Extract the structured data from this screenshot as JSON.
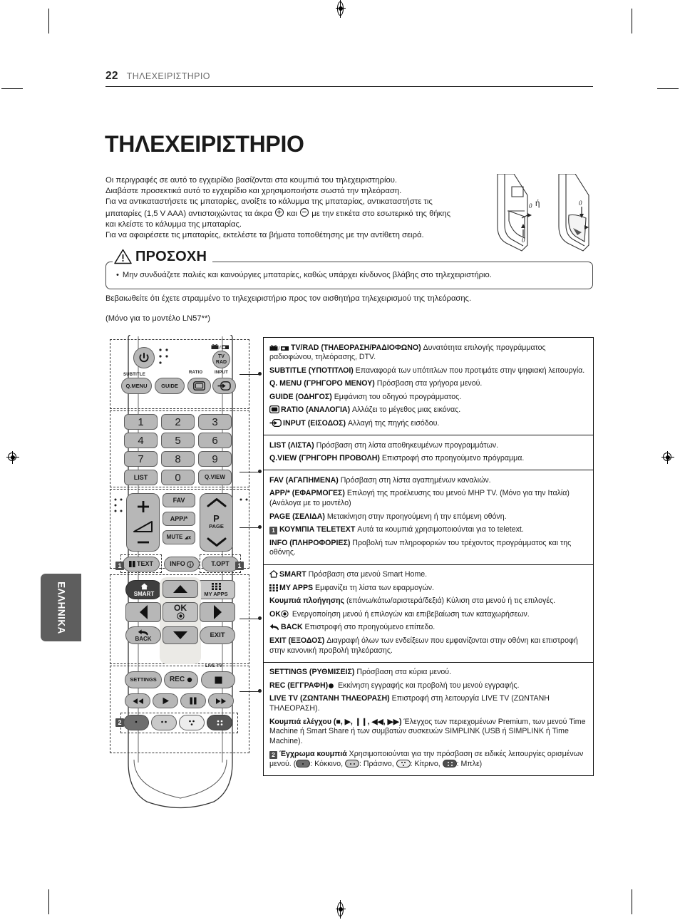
{
  "header": {
    "page_number": "22",
    "breadcrumb": "ΤΗΛΕΧΕΙΡΙΣΤΗΡΙΟ"
  },
  "title": "ΤΗΛΕΧΕΙΡΙΣΤΗΡΙΟ",
  "intro": {
    "line1": "Οι περιγραφές σε αυτό το εγχειρίδιο βασίζονται στα κουμπιά του τηλεχειριστηρίου.",
    "line2": "Διαβάστε προσεκτικά αυτό το εγχειρίδιο και χρησιμοποιήστε σωστά την τηλεόραση.",
    "line3": "Για να αντικαταστήσετε τις μπαταρίες, ανοίξτε το κάλυμμα της μπαταρίας, αντικαταστήστε τις",
    "line4a": "μπαταρίες (1,5 V AAA) αντιστοιχώντας τα άκρα",
    "line4b": "και",
    "line4c": "με την ετικέτα στο εσωτερικό της θήκης",
    "line5": "και κλείστε το κάλυμμα της μπαταρίας.",
    "line6": "Για να αφαιρέσετε τις μπαταρίες, εκτελέστε τα βήματα τοποθέτησης με την αντίθετη σειρά."
  },
  "battery_illustration": {
    "or_label": "ή"
  },
  "caution": {
    "label": "ΠΡΟΣΟΧΗ",
    "bullet_marker": "•",
    "bullet_text": "Μην συνδυάζετε παλιές και καινούργιες μπαταρίες, καθώς υπάρχει κίνδυνος βλάβης στο τηλεχειριστήριο."
  },
  "notes": {
    "note1": "Βεβαιωθείτε ότι έχετε στραμμένο το τηλεχειριστήριο προς τον αισθητήρα τηλεχειρισμού της τηλεόρασης.",
    "note2": "(Μόνο για το μοντέλο LN57**)"
  },
  "language_tab": {
    "label": "ΕΛΛΗΝΙΚΑ"
  },
  "remote": {
    "captions": {
      "subtitle": "SUBTITLE",
      "ratio": "RATIO",
      "input": "INPUT",
      "live_tv": "LIVE TV",
      "tvrad": "TV/RAD"
    },
    "buttons": {
      "power": "⏻",
      "tvrad": "TV\nRAD",
      "qmenu": "Q.MENU",
      "guide": "GUIDE",
      "ratio": "",
      "input": "",
      "n1": "1",
      "n2": "2",
      "n3": "3",
      "n4": "4",
      "n5": "5",
      "n6": "6",
      "n7": "7",
      "n8": "8",
      "n9": "9",
      "list": "LIST",
      "n0": "0",
      "qview": "Q.VIEW",
      "volume": "",
      "fav": "FAV",
      "app": "APP/*",
      "mute": "MUTE",
      "page": "P",
      "page_label": "PAGE",
      "text": "TEXT",
      "info": "INFO",
      "topt": "T.OPT",
      "smart": "SMART",
      "myapps": "MY APPS",
      "ok": "OK",
      "back": "BACK",
      "exit": "EXIT",
      "settings": "SETTINGS",
      "rec": "REC",
      "stop": "■",
      "rewind": "◀◀",
      "play": "▶",
      "pause": "❚❚",
      "forward": "▶▶"
    },
    "callouts": {
      "teletext": "1",
      "color": "2"
    }
  },
  "descriptions": [
    {
      "group": 1,
      "items": [
        {
          "icon": "tv-radio-icon",
          "bold": "TV/RAD (ΤΗΛΕΟΡΑΣΗ/ΡΑΔΙΟΦΩΝΟ)",
          "text": " Δυνατότητα επιλογής προγράμματος ραδιοφώνου, τηλεόρασης, DTV."
        },
        {
          "icon": null,
          "bold": "SUBTITLE (ΥΠΟΤΙΤΛΟΙ)",
          "text": " Επαναφορά των υπότιτλων που προτιμάτε στην ψηφιακή λειτουργία."
        },
        {
          "icon": null,
          "bold": "Q. MENU (ΓΡΗΓΟΡΟ ΜΕΝΟΥ)",
          "text": " Πρόσβαση στα γρήγορα μενού."
        },
        {
          "icon": null,
          "bold": "GUIDE (ΟΔΗΓΟΣ)",
          "text": " Εμφάνιση του οδηγού προγράμματος."
        },
        {
          "icon": "ratio-icon",
          "bold": "RATIO (ΑΝΑΛΟΓΙΑ)",
          "text": " Αλλάζει το μέγεθος μιας εικόνας."
        },
        {
          "icon": "input-icon",
          "bold": "INPUT (ΕΙΣΟΔΟΣ)",
          "text": " Αλλαγή της πηγής εισόδου."
        }
      ]
    },
    {
      "group": 2,
      "items": [
        {
          "icon": null,
          "bold": "LIST (ΛΙΣΤΑ)",
          "text": " Πρόσβαση στη λίστα αποθηκευμένων προγραμμάτων."
        },
        {
          "icon": null,
          "bold": "Q.VIEW (ΓΡΗΓΟΡΗ ΠΡΟΒΟΛΗ)",
          "text": " Επιστροφή στο προηγούμενο πρόγραμμα."
        }
      ]
    },
    {
      "group": 3,
      "items": [
        {
          "icon": null,
          "bold": "FAV (ΑΓΑΠΗΜΕΝΑ)",
          "text": " Πρόσβαση στη λίστα αγαπημένων καναλιών."
        },
        {
          "icon": null,
          "bold": "APP/* (ΕΦΑΡΜΟΓΕΣ)",
          "text": " Επιλογή της προέλευσης του μενού MHP TV. (Μόνο για την Ιταλία) (Ανάλογα με το μοντέλο)"
        },
        {
          "icon": null,
          "bold": "PAGE (ΣΕΛΙΔΑ)",
          "text": " Μετακίνηση στην προηγούμενη ή την επόμενη οθόνη."
        },
        {
          "icon": "callout-1",
          "bold": "ΚΟΥΜΠΙΑ TELETEXT",
          "text": " Αυτά τα κουμπιά χρησιμοποιούνται για το teletext."
        },
        {
          "icon": null,
          "bold": "INFO (ΠΛΗΡΟΦΟΡΙΕΣ)",
          "text": " Προβολή των πληροφοριών του τρέχοντος προγράμματος και της οθόνης."
        }
      ]
    },
    {
      "group": 4,
      "items": [
        {
          "icon": "home-icon",
          "bold": "SMART",
          "text": " Πρόσβαση στα μενού Smart Home."
        },
        {
          "icon": "grid-icon",
          "bold": "MY APPS",
          "text": " Εμφανίζει τη λίστα των εφαρμογών."
        },
        {
          "icon": null,
          "bold": "Κουμπιά πλοήγησης",
          "text": " (επάνω/κάτω/αριστερά/δεξιά) Κύλιση στα μενού ή τις επιλογές."
        },
        {
          "icon": "ok-icon",
          "bold": "OK",
          "text": " Ενεργοποίηση μενού ή επιλογών και επιβεβαίωση των καταχωρήσεων."
        },
        {
          "icon": "back-arrow-icon",
          "bold": "BACK",
          "text": " Επιστροφή στο προηγούμενο επίπεδο."
        },
        {
          "icon": null,
          "bold": "EXIT (ΕΞΟΔΟΣ)",
          "text": " Διαγραφή όλων των ενδείξεων που εμφανίζονται στην οθόνη και επιστροφή στην κανονική προβολή τηλεόρασης."
        }
      ]
    },
    {
      "group": 5,
      "items": [
        {
          "icon": null,
          "bold": "SETTINGS (ΡΥΘΜΙΣΕΙΣ)",
          "text": " Πρόσβαση στα κύρια μενού."
        },
        {
          "icon": "record-dot-icon",
          "bold": "REC (ΕΓΓΡΑΦΗ)",
          "text": " Εκκίνηση εγγραφής και προβολή του μενού εγγραφής."
        },
        {
          "icon": null,
          "bold": "LIVE TV (ΖΩΝΤΑΝΗ ΤΗΛΕΟΡΑΣΗ)",
          "text": " Επιστροφή στη λειτουργία LIVE TV (ΖΩΝΤΑΝΗ ΤΗΛΕΟΡΑΣΗ)."
        },
        {
          "icon": "transport-icons",
          "bold": "Κουμπιά ελέγχου",
          "text": " Έλεγχος των περιεχομένων Premium, των μενού Time Machine ή Smart Share ή των συμβατών συσκευών SIMPLINK (USB ή SIMPLINK ή Time Machine)."
        },
        {
          "icon": "callout-2",
          "bold": "Έγχρωμα κουμπιά",
          "text": " Χρησιμοποιούνται για την πρόσβαση σε ειδικές λειτουργίες ορισμένων μενού."
        }
      ]
    }
  ],
  "color_buttons": {
    "prefix": "(",
    "red": ": Κόκκινο,",
    "green": ": Πράσινο,",
    "yellow": ": Κίτρινο,",
    "blue": ": Μπλε)"
  }
}
